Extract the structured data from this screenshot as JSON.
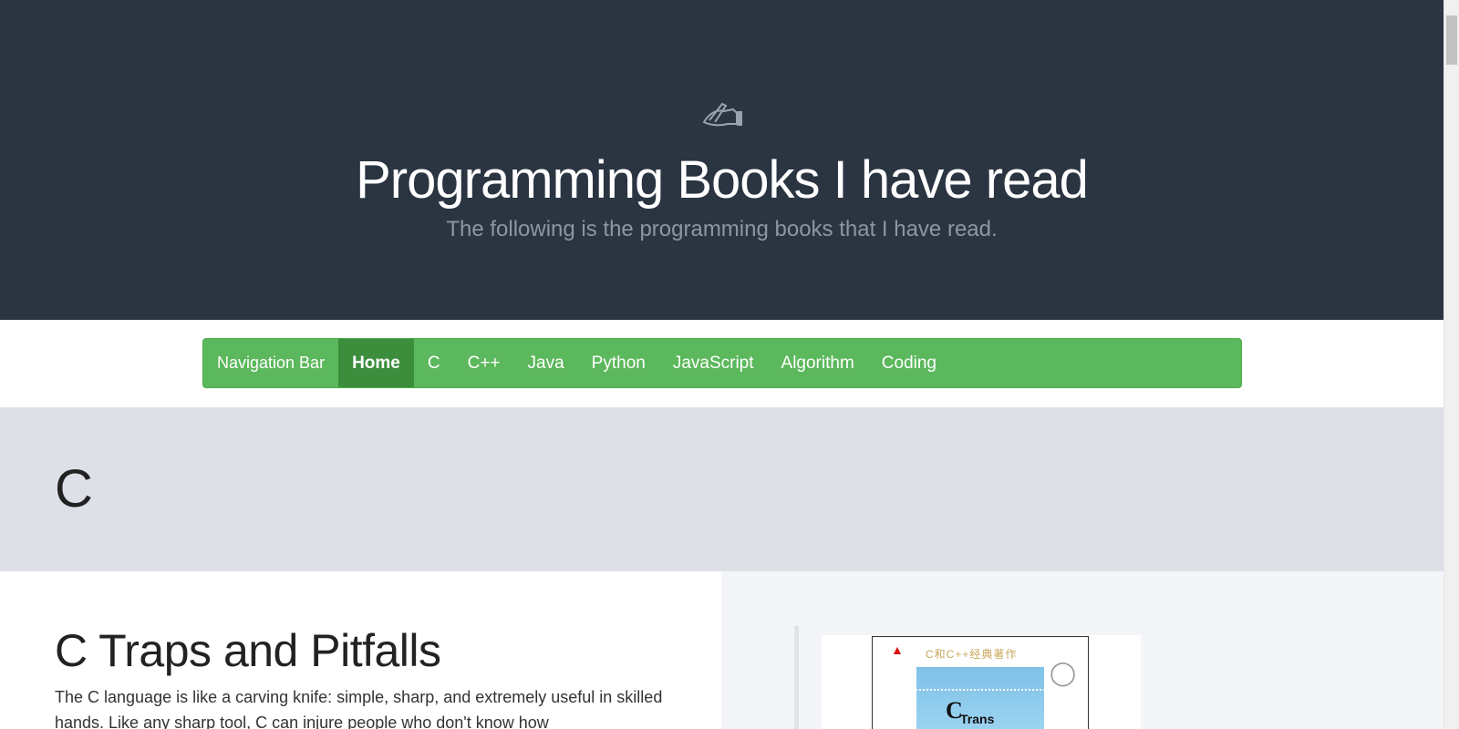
{
  "hero": {
    "icon": "hand-writing-icon",
    "title": "Programming Books I have read",
    "subtitle": "The following is the programming books that I have read."
  },
  "nav": {
    "brand": "Navigation Bar",
    "items": [
      {
        "label": "Home",
        "active": true
      },
      {
        "label": "C"
      },
      {
        "label": "C++"
      },
      {
        "label": "Java"
      },
      {
        "label": "Python"
      },
      {
        "label": "JavaScript"
      },
      {
        "label": "Algorithm"
      },
      {
        "label": "Coding"
      }
    ]
  },
  "section": {
    "heading": "C"
  },
  "book": {
    "title": "C Traps and Pitfalls",
    "description": "The C language is like a carving knife: simple, sharp, and extremely useful in skilled hands. Like any sharp tool, C can injure people who don't know how",
    "cover": {
      "series_text": "C和C++经典著作",
      "word": "C",
      "word_small": "Trans"
    }
  },
  "colors": {
    "hero_bg": "#2b3542",
    "nav_bg": "#5cb85c",
    "nav_active": "#3c8d3c",
    "section_bg": "#dde0e7"
  }
}
